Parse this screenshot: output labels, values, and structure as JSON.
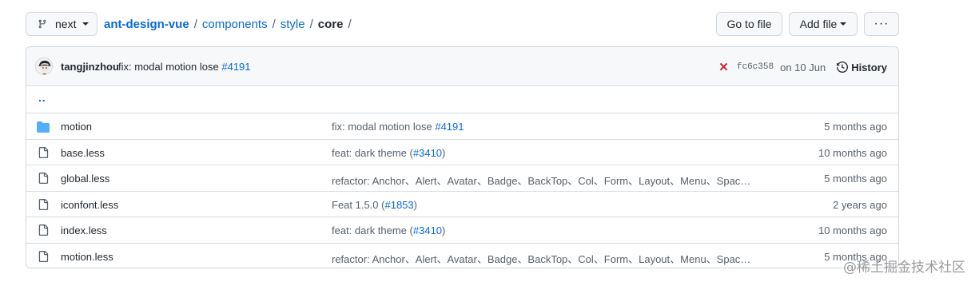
{
  "topbar": {
    "branch": "next",
    "breadcrumb": {
      "root": "ant-design-vue",
      "parts": [
        "components",
        "style"
      ],
      "current": "core",
      "sep": "/"
    },
    "goto_file": "Go to file",
    "add_file": "Add file",
    "more": "···"
  },
  "commit": {
    "author": "tangjinzhou",
    "message": "fix: modal motion lose",
    "pr": "#4191",
    "status_icon": "x-icon",
    "status_color": "#cf222e",
    "sha": "fc6c358",
    "date": "on 10 Jun",
    "history": "History"
  },
  "parent_link": "..",
  "files": [
    {
      "type": "folder",
      "name": "motion",
      "message": "fix: modal motion lose ",
      "pr": "#4191",
      "pr_wrap": false,
      "age": "5 months ago"
    },
    {
      "type": "file",
      "name": "base.less",
      "message": "feat: dark theme (",
      "pr": "#3410",
      "suffix": ")",
      "age": "10 months ago"
    },
    {
      "type": "file",
      "name": "global.less",
      "message": "refactor: Anchor、Alert、Avatar、Badge、BackTop、Col、Form、Layout、Menu、Spac…",
      "pr": "",
      "suffix": "",
      "age": "5 months ago"
    },
    {
      "type": "file",
      "name": "iconfont.less",
      "message": "Feat 1.5.0 (",
      "pr": "#1853",
      "suffix": ")",
      "age": "2 years ago"
    },
    {
      "type": "file",
      "name": "index.less",
      "message": "feat: dark theme (",
      "pr": "#3410",
      "suffix": ")",
      "age": "10 months ago"
    },
    {
      "type": "file",
      "name": "motion.less",
      "message": "refactor: Anchor、Alert、Avatar、Badge、BackTop、Col、Form、Layout、Menu、Spac…",
      "pr": "",
      "suffix": "",
      "age": "5 months ago"
    }
  ],
  "watermark": "@稀土掘金技术社区",
  "colors": {
    "link": "#0969da",
    "folder": "#54aeff",
    "border": "#d0d7de"
  }
}
